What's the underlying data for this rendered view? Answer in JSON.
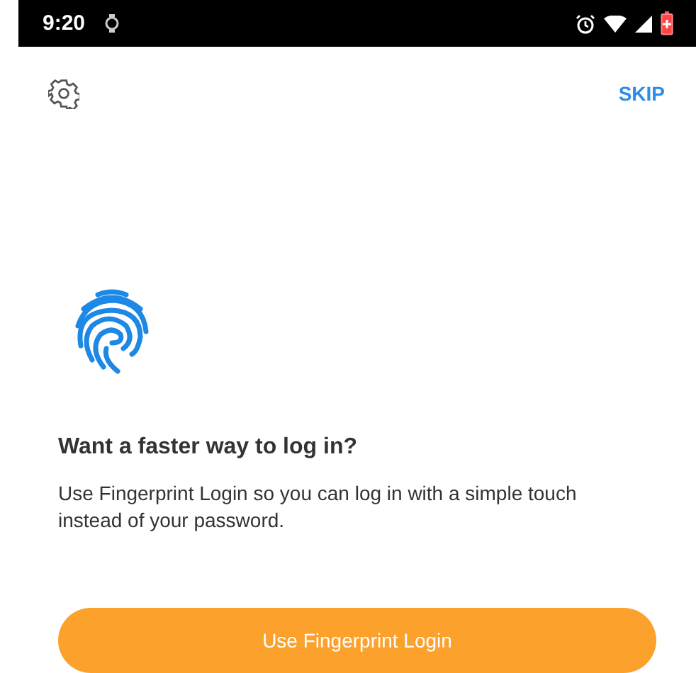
{
  "status_bar": {
    "time": "9:20"
  },
  "toolbar": {
    "skip": "SKIP"
  },
  "prompt": {
    "title": "Want a faster way to log in?",
    "body": "Use Fingerprint Login so you can log in with a simple touch instead of your password."
  },
  "buttons": [
    {
      "label": "Use Fingerprint Login"
    }
  ]
}
